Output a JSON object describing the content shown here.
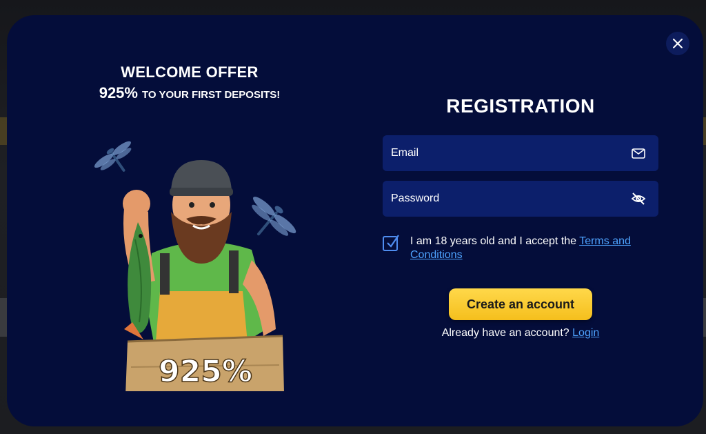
{
  "promo": {
    "title": "WELCOME OFFER",
    "percent": "925%",
    "subtitle": "TO YOUR FIRST DEPOSITS!",
    "sign_text": "925%"
  },
  "registration": {
    "title": "REGISTRATION",
    "email_placeholder": "Email",
    "password_placeholder": "Password",
    "terms_prefix": "I am 18 years old and I accept the ",
    "terms_link": "Terms and Conditions",
    "terms_checked": true,
    "create_button": "Create an account",
    "login_prompt": "Already have an account? ",
    "login_link": "Login"
  },
  "icons": {
    "close": "close-icon",
    "email": "mail-icon",
    "password": "eye-off-icon",
    "checkbox": "check-icon"
  },
  "colors": {
    "modal_bg": "#040d3a",
    "field_bg": "#0c1f6b",
    "button_gold": "#f5bf1d",
    "link_blue": "#4ea3ff"
  }
}
